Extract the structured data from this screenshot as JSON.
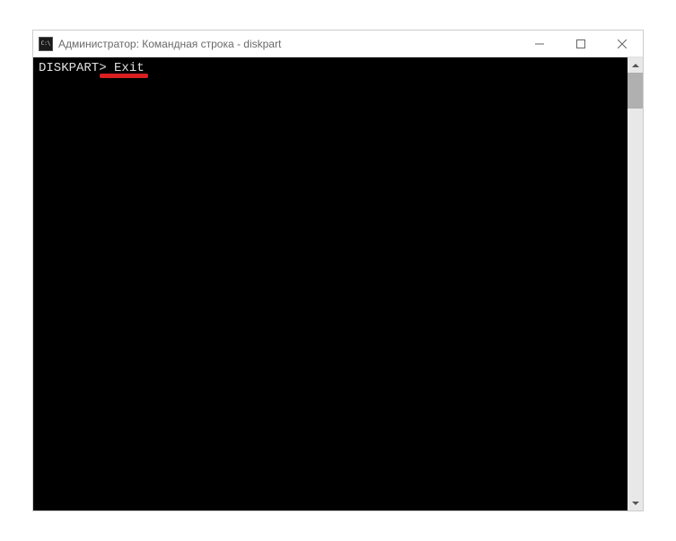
{
  "window": {
    "title": "Администратор: Командная строка - diskpart"
  },
  "terminal": {
    "prompt": "DISKPART>",
    "command": "Exit"
  }
}
